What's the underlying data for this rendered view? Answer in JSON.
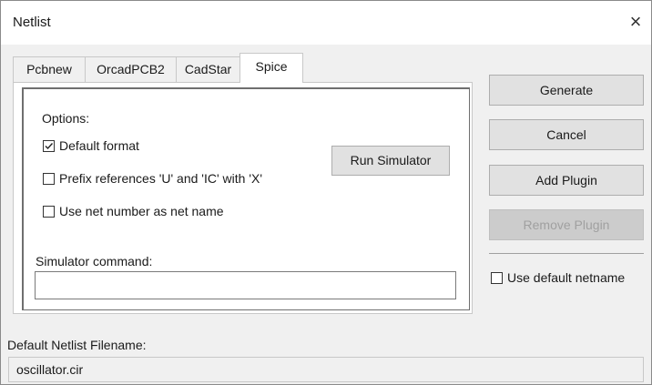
{
  "window": {
    "title": "Netlist",
    "close_icon": "×"
  },
  "tabs": [
    {
      "label": "Pcbnew",
      "active": false
    },
    {
      "label": "OrcadPCB2",
      "active": false
    },
    {
      "label": "CadStar",
      "active": false
    },
    {
      "label": "Spice",
      "active": true
    }
  ],
  "spice": {
    "options_label": "Options:",
    "default_format": {
      "label": "Default format",
      "checked": true
    },
    "prefix_refs": {
      "label": "Prefix references 'U' and 'IC' with 'X'",
      "checked": false
    },
    "use_net_number": {
      "label": "Use net number as net name",
      "checked": false
    },
    "run_simulator_label": "Run Simulator",
    "simulator_command_label": "Simulator command:",
    "simulator_command_value": ""
  },
  "actions": {
    "generate": "Generate",
    "cancel": "Cancel",
    "add_plugin": "Add Plugin",
    "remove_plugin": "Remove Plugin",
    "remove_plugin_enabled": false,
    "use_default_netname": {
      "label": "Use default netname",
      "checked": false
    }
  },
  "footer": {
    "filename_label": "Default Netlist Filename:",
    "filename_value": "oscillator.cir"
  }
}
